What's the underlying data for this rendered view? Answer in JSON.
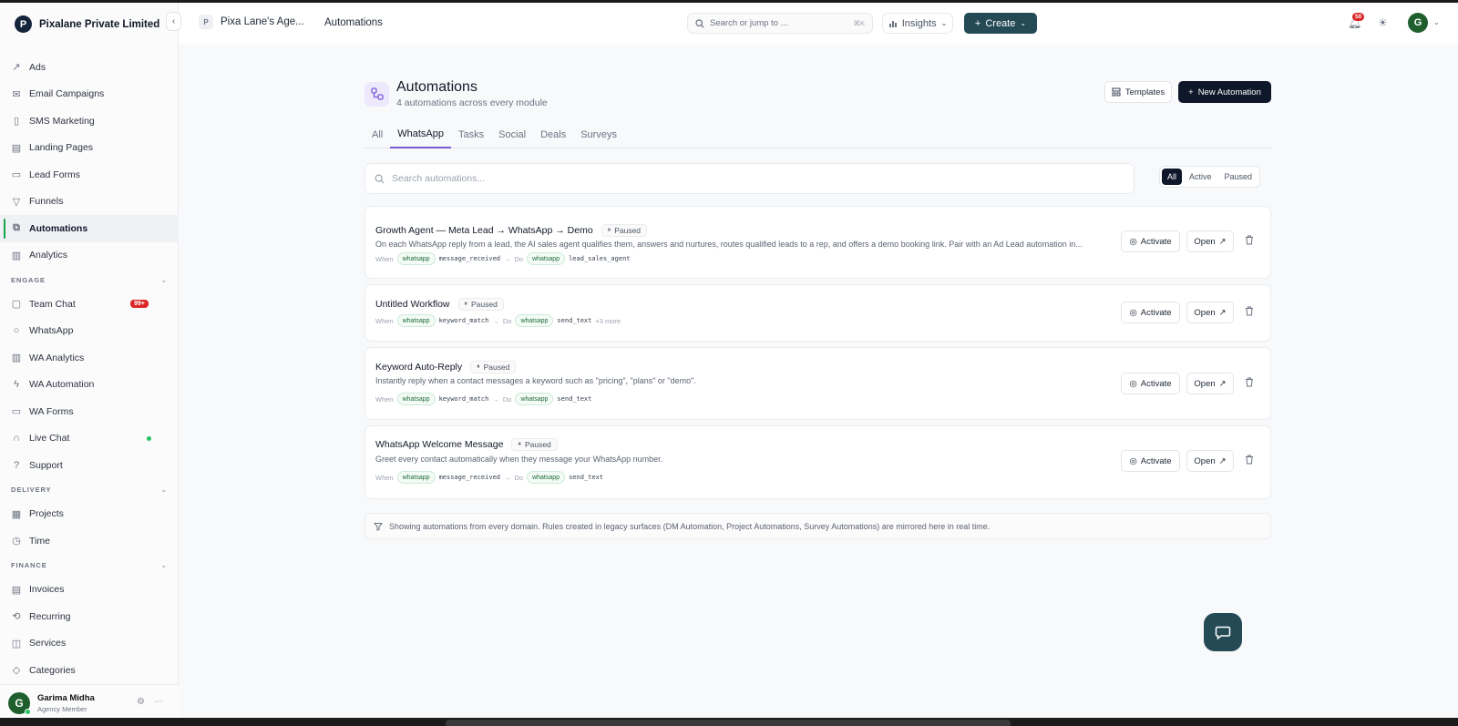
{
  "app": {
    "company": "Pixalane Private Limited",
    "logo_letter": "P"
  },
  "sidebar": {
    "items_top": [
      {
        "label": "Ads",
        "icon": "trend-icon"
      },
      {
        "label": "Email Campaigns",
        "icon": "mail-icon"
      },
      {
        "label": "SMS Marketing",
        "icon": "phone-icon"
      },
      {
        "label": "Landing Pages",
        "icon": "layout-icon"
      },
      {
        "label": "Lead Forms",
        "icon": "form-icon"
      },
      {
        "label": "Funnels",
        "icon": "funnel-icon"
      },
      {
        "label": "Automations",
        "icon": "workflow-icon",
        "active": true
      },
      {
        "label": "Analytics",
        "icon": "chart-icon"
      }
    ],
    "engage_label": "ENGAGE",
    "items_engage": [
      {
        "label": "Team Chat",
        "icon": "chat-icon",
        "badge": "99+"
      },
      {
        "label": "WhatsApp",
        "icon": "whatsapp-icon"
      },
      {
        "label": "WA Analytics",
        "icon": "chart-icon"
      },
      {
        "label": "WA Automation",
        "icon": "bolt-icon"
      },
      {
        "label": "WA Forms",
        "icon": "form-icon"
      },
      {
        "label": "Live Chat",
        "icon": "headset-icon",
        "online": true
      },
      {
        "label": "Support",
        "icon": "help-icon"
      }
    ],
    "delivery_label": "DELIVERY",
    "items_delivery": [
      {
        "label": "Projects",
        "icon": "projects-icon"
      },
      {
        "label": "Time",
        "icon": "clock-icon"
      }
    ],
    "finance_label": "FINANCE",
    "items_finance": [
      {
        "label": "Invoices",
        "icon": "invoice-icon"
      },
      {
        "label": "Recurring",
        "icon": "repeat-icon"
      },
      {
        "label": "Services",
        "icon": "box-icon"
      },
      {
        "label": "Categories",
        "icon": "tag-icon"
      }
    ],
    "user": {
      "initial": "G",
      "name": "Garima Midha",
      "role": "Agency Member"
    }
  },
  "header": {
    "workspace_initial": "P",
    "workspace_name": "Pixa Lane's Age...",
    "title": "Automations",
    "search_placeholder": "Search or jump to ...",
    "search_shortcut": "⌘K",
    "insights_label": "Insights",
    "create_label": "Create",
    "notifications_count": "50",
    "avatar_initial": "G"
  },
  "page": {
    "title": "Automations",
    "subtitle": "4 automations across every module",
    "templates_label": "Templates",
    "new_label": "New Automation",
    "tabs": [
      "All",
      "WhatsApp",
      "Tasks",
      "Social",
      "Deals",
      "Surveys"
    ],
    "active_tab": 1,
    "search_placeholder": "Search automations...",
    "filters": [
      "All",
      "Active",
      "Paused"
    ],
    "active_filter": 0,
    "when_label": "When",
    "do_label": "Do",
    "activate_label": "Activate",
    "open_label": "Open",
    "footer_note": "Showing automations from every domain. Rules created in legacy surfaces (DM Automation, Project Automations, Survey Automations) are mirrored here in real time."
  },
  "automations": [
    {
      "title": "Growth Agent — Meta Lead → WhatsApp → Demo",
      "status": "Paused",
      "description": "On each WhatsApp reply from a lead, the AI sales agent qualifies them, answers and nurtures, routes qualified leads to a rep, and offers a demo booking link. Pair with an Ad Lead automation in...",
      "trigger_chip": "whatsapp",
      "trigger": "message_received",
      "action_chip": "whatsapp",
      "action": "lead_sales_agent",
      "more": ""
    },
    {
      "title": "Untitled Workflow",
      "status": "Paused",
      "description": "",
      "trigger_chip": "whatsapp",
      "trigger": "keyword_match",
      "action_chip": "whatsapp",
      "action": "send_text",
      "more": "+3 more"
    },
    {
      "title": "Keyword Auto-Reply",
      "status": "Paused",
      "description": "Instantly reply when a contact messages a keyword such as \"pricing\", \"plans\" or \"demo\".",
      "trigger_chip": "whatsapp",
      "trigger": "keyword_match",
      "action_chip": "whatsapp",
      "action": "send_text",
      "more": ""
    },
    {
      "title": "WhatsApp Welcome Message",
      "status": "Paused",
      "description": "Greet every contact automatically when they message your WhatsApp number.",
      "trigger_chip": "whatsapp",
      "trigger": "message_received",
      "action_chip": "whatsapp",
      "action": "send_text",
      "more": ""
    }
  ],
  "colors": {
    "accent_purple": "#7c5cd6",
    "create_button": "#244a56",
    "primary_dark": "#0f172a",
    "active_indicator": "#16a34a",
    "badge_red": "#dc2626"
  }
}
